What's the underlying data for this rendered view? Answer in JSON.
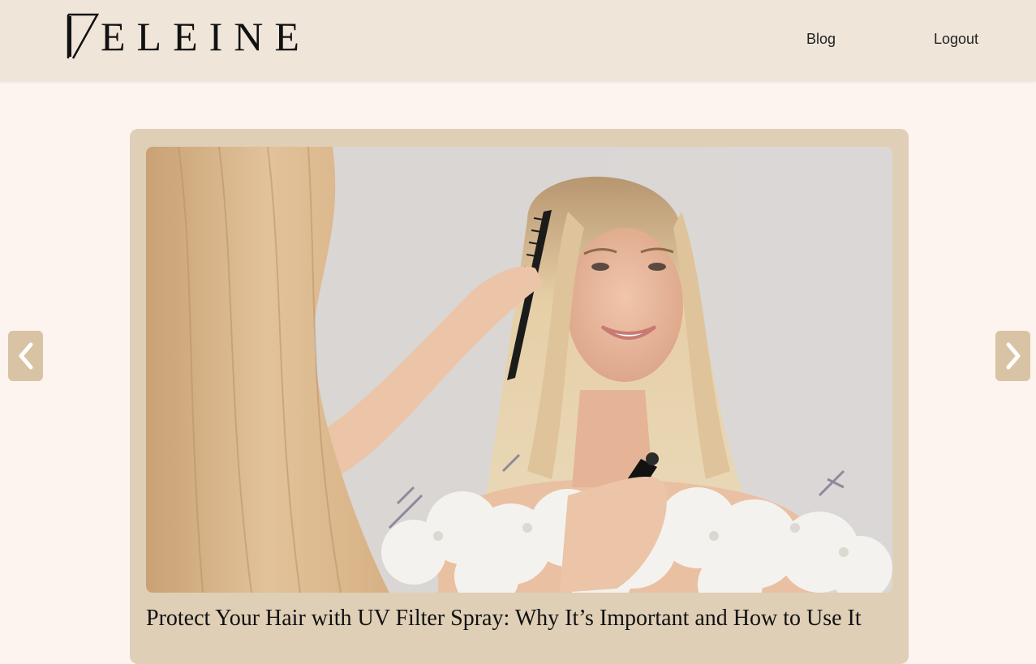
{
  "header": {
    "logo_text": "ELEINE",
    "nav": {
      "blog_label": "Blog",
      "logout_label": "Logout"
    }
  },
  "carousel": {
    "prev_icon": "chevron-left-icon",
    "next_icon": "chevron-right-icon",
    "post": {
      "title": "Protect Your Hair with UV Filter Spray: Why It’s Important and How to Use It"
    }
  },
  "colors": {
    "header_bg": "#efe5d9",
    "page_bg": "#fdf4ef",
    "card_bg": "#dfcfb6",
    "arrow_bg": "#d8c3a4"
  }
}
